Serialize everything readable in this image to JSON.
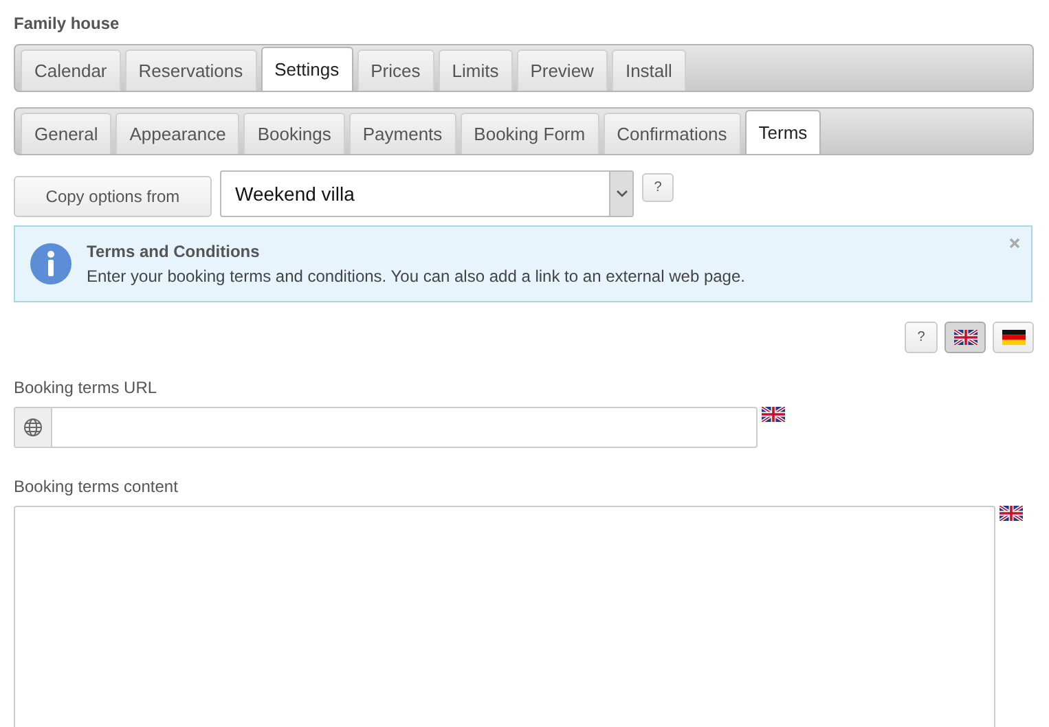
{
  "title": "Family house",
  "main_tabs": [
    {
      "label": "Calendar",
      "selected": false
    },
    {
      "label": "Reservations",
      "selected": false
    },
    {
      "label": "Settings",
      "selected": true
    },
    {
      "label": "Prices",
      "selected": false
    },
    {
      "label": "Limits",
      "selected": false
    },
    {
      "label": "Preview",
      "selected": false
    },
    {
      "label": "Install",
      "selected": false
    }
  ],
  "sub_tabs": [
    {
      "label": "General",
      "selected": false
    },
    {
      "label": "Appearance",
      "selected": false
    },
    {
      "label": "Bookings",
      "selected": false
    },
    {
      "label": "Payments",
      "selected": false
    },
    {
      "label": "Booking Form",
      "selected": false
    },
    {
      "label": "Confirmations",
      "selected": false
    },
    {
      "label": "Terms",
      "selected": true
    }
  ],
  "copy_button": "Copy options from",
  "copy_select": {
    "value": "Weekend villa"
  },
  "help_button": "?",
  "info": {
    "title": "Terms and Conditions",
    "text": "Enter your booking terms and conditions. You can also add a link to an external web page."
  },
  "language_help": "?",
  "languages": [
    {
      "kind": "uk",
      "selected": true
    },
    {
      "kind": "de",
      "selected": false
    }
  ],
  "url_field": {
    "label": "Booking terms URL",
    "flag": {
      "kind": "uk"
    }
  },
  "content_field": {
    "label": "Booking terms content",
    "flag": {
      "kind": "uk"
    }
  }
}
